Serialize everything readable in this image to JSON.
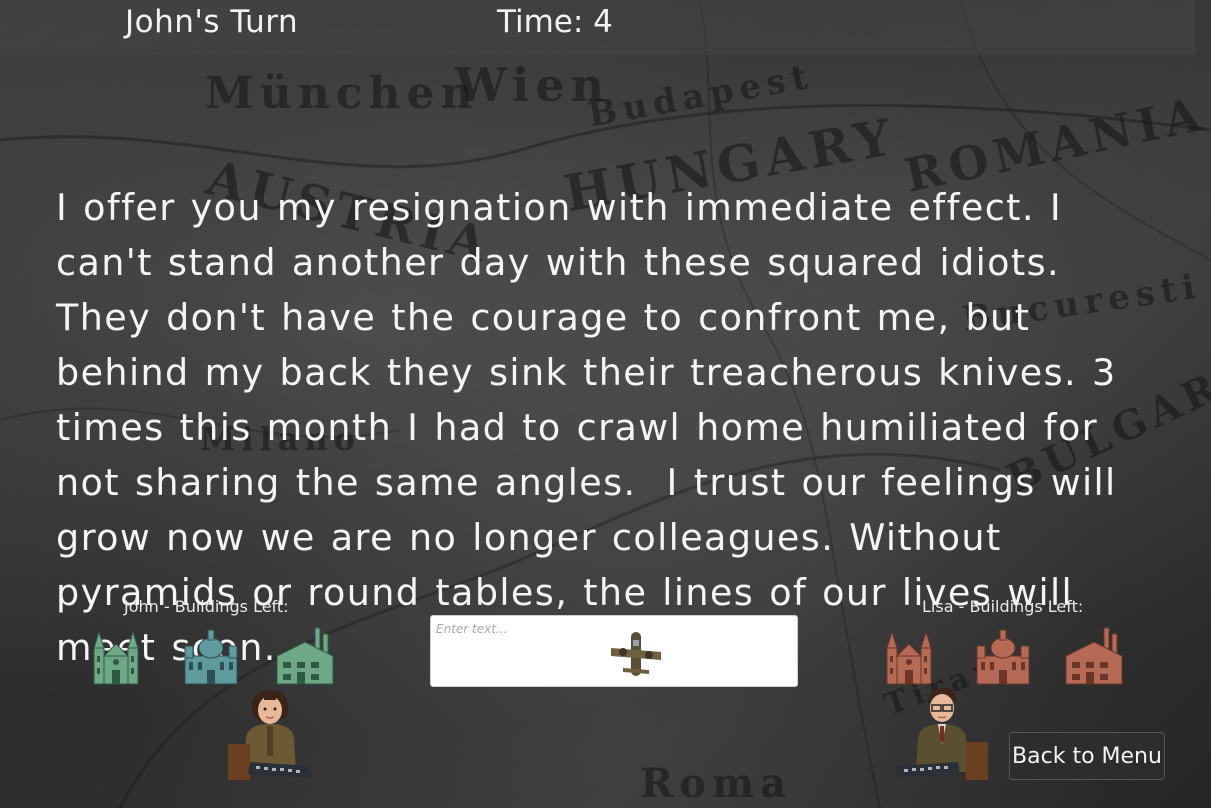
{
  "header": {
    "turn_label": "John's Turn",
    "time_label": "Time: 4"
  },
  "map_labels": [
    "München",
    "Wien",
    "Budapest",
    "AUSTRIA",
    "HUNGARY",
    "ROMANIA",
    "BULGARIA",
    "Bucuresti",
    "Milano",
    "Roma",
    "Tirana"
  ],
  "message": "I offer you my resignation with immediate effect. I can't stand another day with these squared idiots. They don't have the courage to confront me, but behind my back they sink their treacherous knives. 3 times this month I had to crawl home humiliated for not sharing the same angles.  I trust our feelings will grow now we are no longer colleagues. Without pyramids or round tables, the lines of our lives will meet soon.",
  "players": {
    "left": {
      "title": "John - Buildings Left:",
      "color": "#6fa886",
      "buildings": [
        "cathedral-icon",
        "palace-icon",
        "factory-icon"
      ]
    },
    "right": {
      "title": "Lisa - Buildings Left:",
      "color": "#b46a55",
      "buildings": [
        "cathedral-icon",
        "palace-icon",
        "factory-icon"
      ]
    }
  },
  "input": {
    "placeholder": "Enter text...",
    "icon": "plane-icon"
  },
  "back_button": "Back to Menu"
}
